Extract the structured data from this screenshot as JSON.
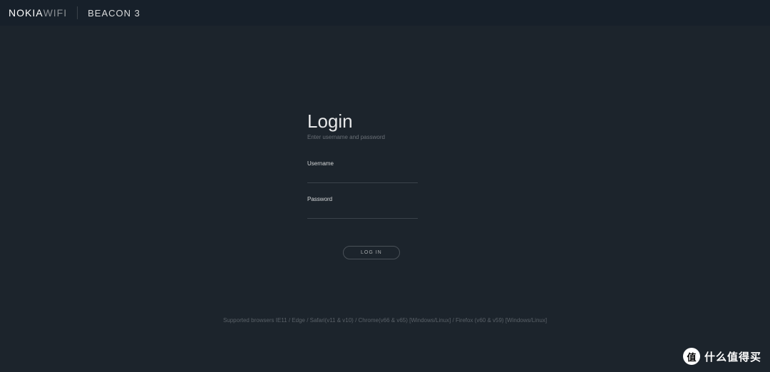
{
  "header": {
    "brand_bold": "NOKIA",
    "brand_light": "WIFI",
    "product": "BEACON 3"
  },
  "login": {
    "title": "Login",
    "subtitle": "Enter username and password",
    "username_label": "Username",
    "username_value": "",
    "password_label": "Password",
    "password_value": "",
    "button": "LOG IN"
  },
  "footer": {
    "text": "Supported browsers IE11 / Edge / Safari(v11 & v10) / Chrome(v66 & v65) [Windows/Linux] / Firefox (v60 & v59) [Windows/Linux]"
  },
  "watermark": {
    "badge": "值",
    "text": "什么值得买"
  }
}
